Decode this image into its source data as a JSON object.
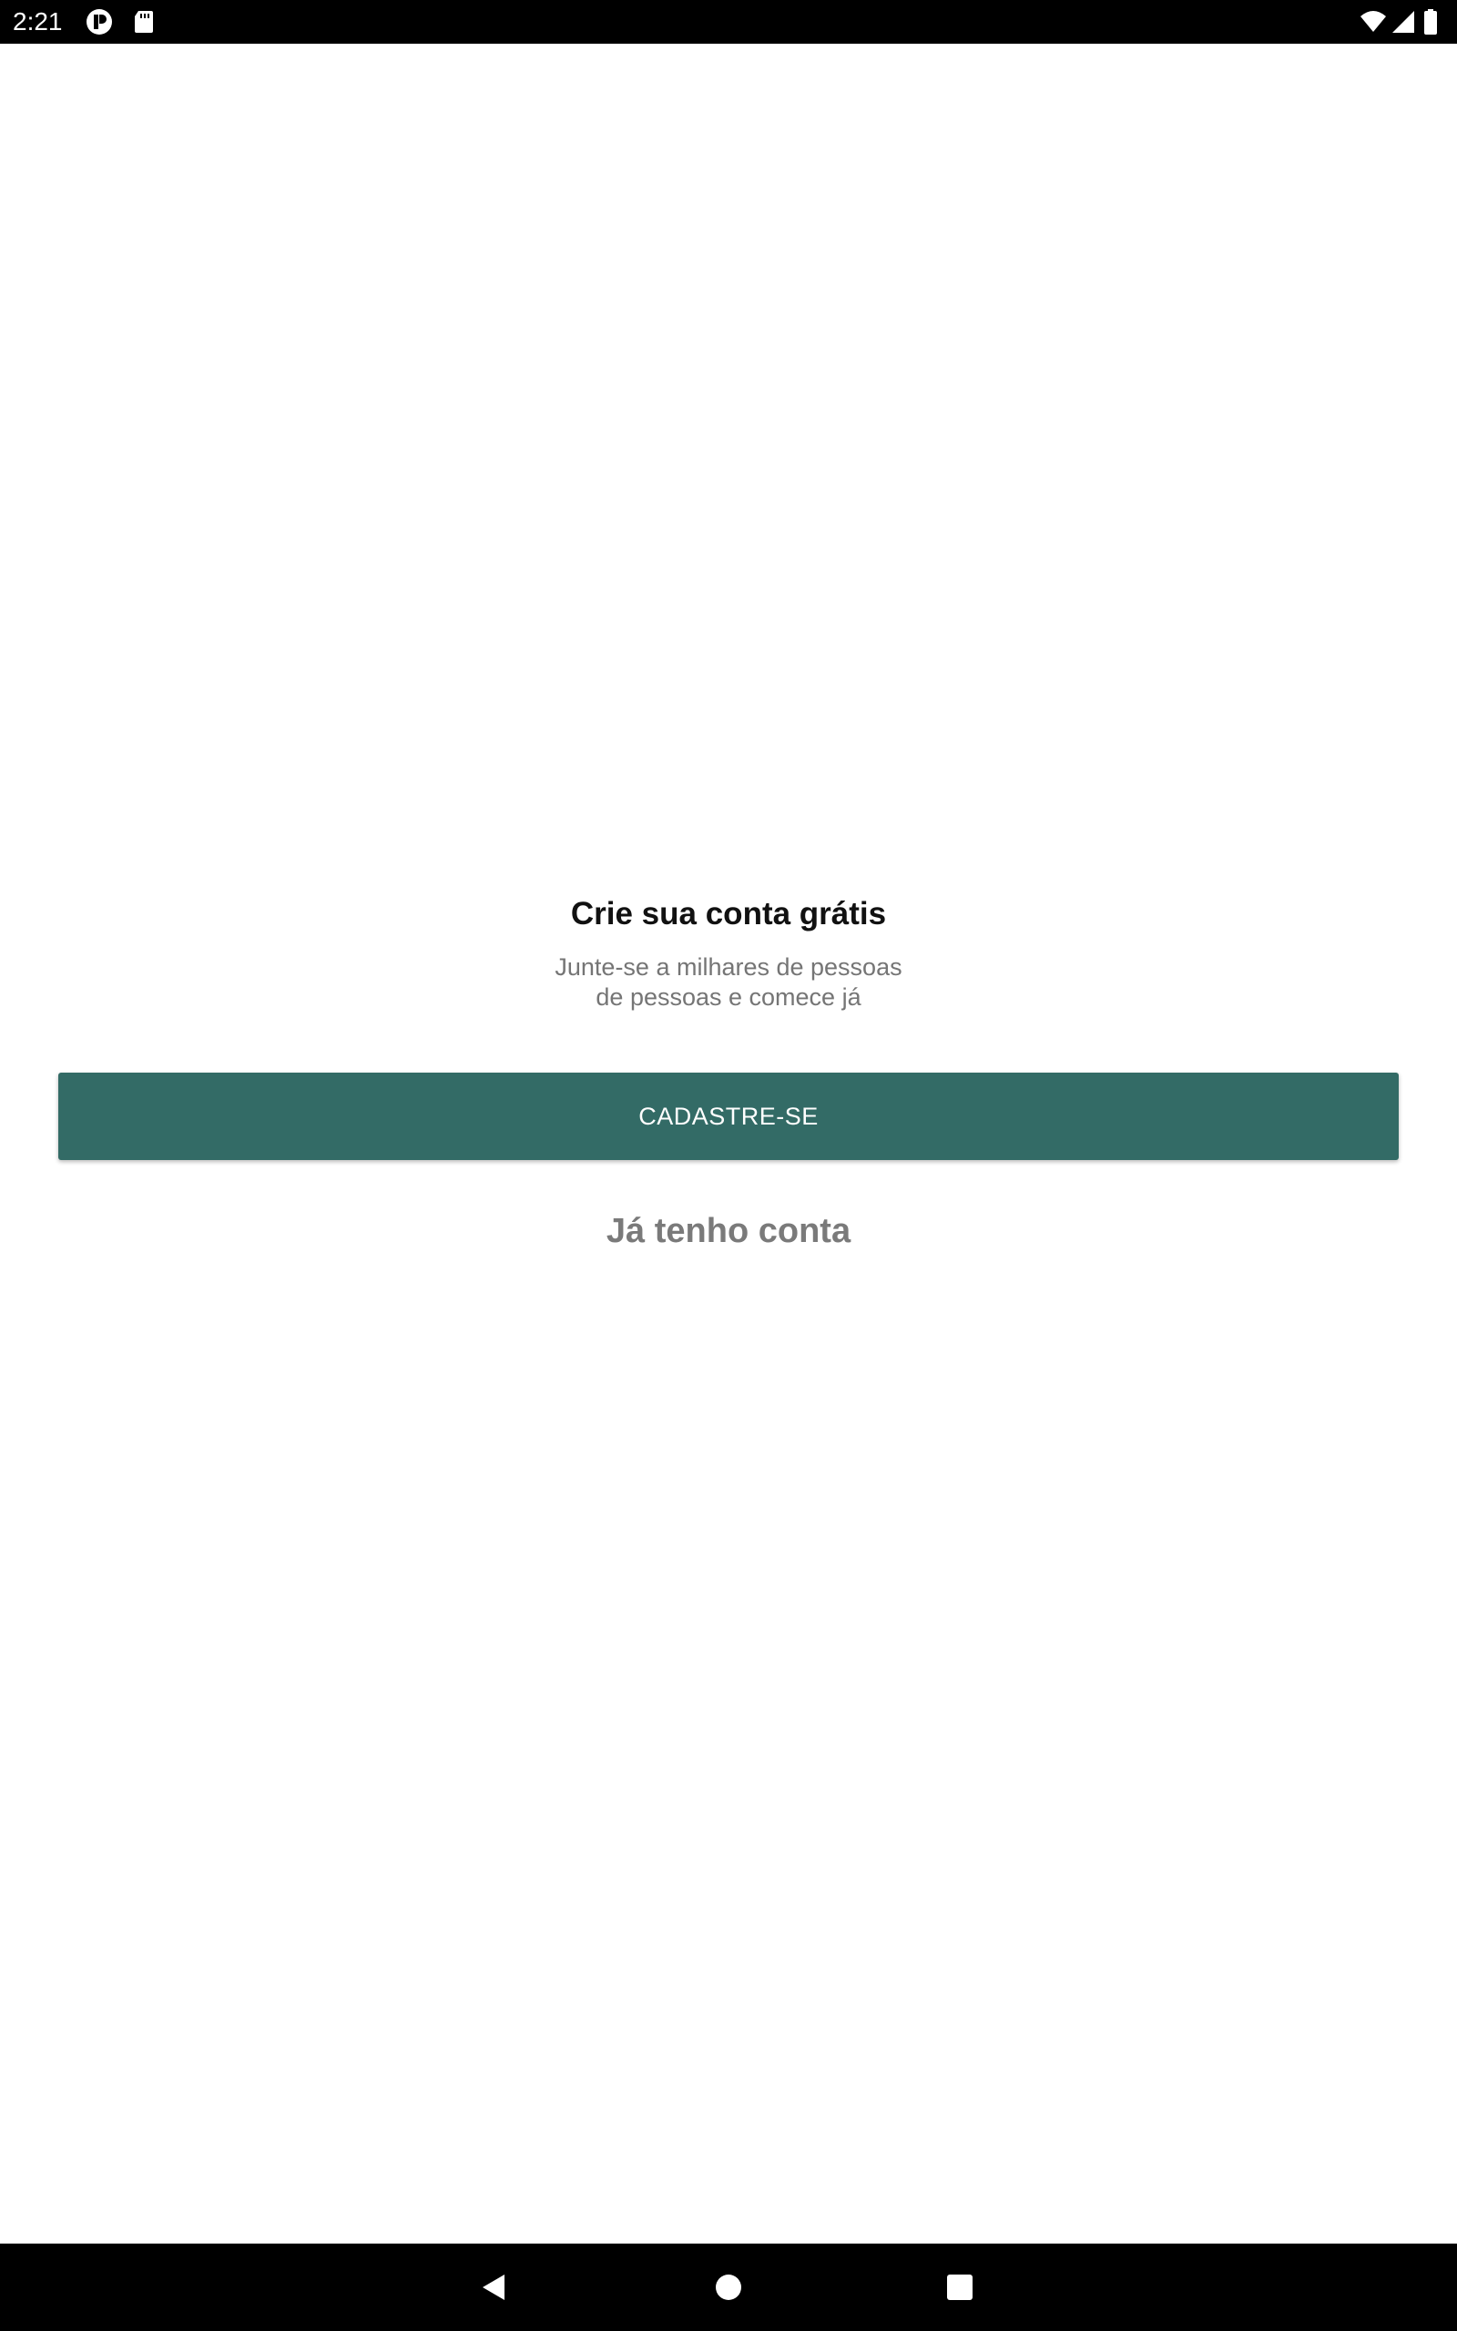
{
  "status_bar": {
    "time": "2:21",
    "left_icons": [
      "notification-app-icon",
      "sd-card-icon"
    ],
    "right_icons": [
      "wifi-icon",
      "cell-signal-icon",
      "battery-icon"
    ]
  },
  "main": {
    "title": "Crie sua conta grátis",
    "subtitle_line1": "Junte-se a milhares de pessoas",
    "subtitle_line2": "de pessoas e comece já",
    "signup_button_label": "CADASTRE-SE",
    "login_link_label": "Já tenho conta"
  },
  "nav_bar": {
    "buttons": [
      "back-icon",
      "home-icon",
      "recents-icon"
    ]
  },
  "colors": {
    "accent": "#336b66",
    "title_text": "#111111",
    "subtitle_text": "#757575",
    "link_text": "#7a7a7a",
    "bars": "#000000"
  }
}
